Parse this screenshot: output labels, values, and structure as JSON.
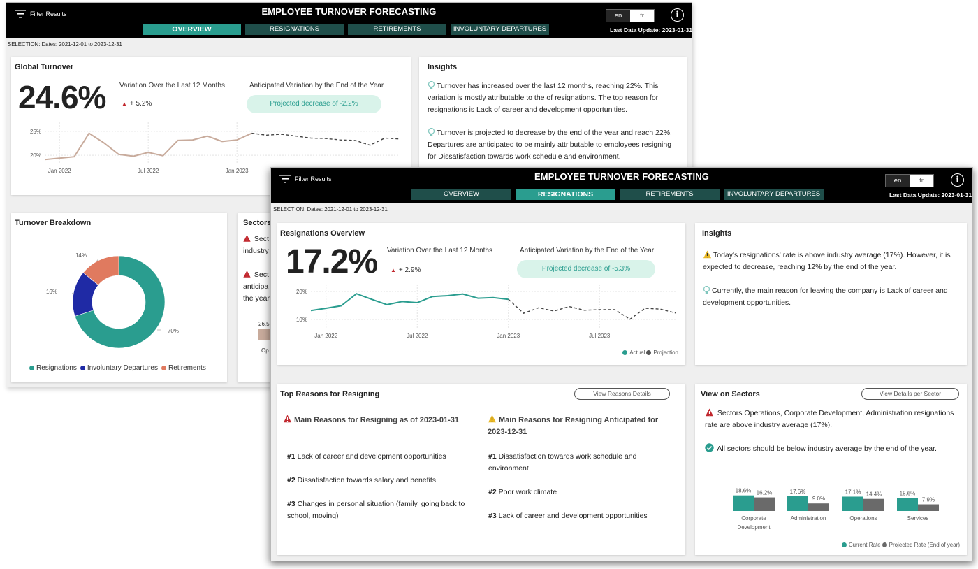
{
  "app": {
    "filter_label": "Filter Results",
    "title": "EMPLOYEE TURNOVER FORECASTING",
    "tabs": [
      "OVERVIEW",
      "RESIGNATIONS",
      "RETIREMENTS",
      "INVOLUNTARY DEPARTURES"
    ],
    "lang_en": "en",
    "lang_fr": "fr",
    "info_glyph": "i",
    "last_update_label": "Last Data Update:",
    "last_update_value": "2023-01-31",
    "selection": "SELECTION: Dates: 2021-12-01 to 2023-12-31"
  },
  "overview": {
    "active_tab": "OVERVIEW",
    "global_turnover": {
      "title": "Global Turnover",
      "value": "24.6%",
      "variation_label": "Variation Over the Last 12 Months",
      "variation_value": "+ 5.2%",
      "anticipated_label": "Anticipated Variation by the End of the Year",
      "projected_pill": "Projected decrease of -2.2%"
    },
    "insights": {
      "title": "Insights",
      "p1": "Turnover has increased over the last 12 months, reaching 22%. This variation is mostly attributable to the of resignations. The top reason for resignations is Lack of career and development opportunities.",
      "p2": "Turnover is projected to decrease by the end of the year and reach 22%. Departures are anticipated to be mainly attributable to employees resigning for Dissatisfaction towards work schedule and environment."
    },
    "breakdown": {
      "title": "Turnover Breakdown",
      "legend": [
        "Resignations",
        "Involuntary Departures",
        "Retirements"
      ]
    },
    "sectors": {
      "title": "Sectors",
      "line1": "Sect",
      "line1b": "industry",
      "line2": "Sect",
      "line2b": "anticipa",
      "line2c": "the year",
      "bar_label": "26.5",
      "cat_label": "Op"
    }
  },
  "resignations": {
    "active_tab": "RESIGNATIONS",
    "overview": {
      "title": "Resignations Overview",
      "value": "17.2%",
      "variation_label": "Variation Over the Last 12 Months",
      "variation_value": "+ 2.9%",
      "anticipated_label": "Anticipated Variation by the End of the Year",
      "projected_pill": "Projected decrease of -5.3%",
      "legend_actual": "Actual",
      "legend_projection": "Projection"
    },
    "insights": {
      "title": "Insights",
      "p1": "Today's resignations' rate is above industry average (17%). However, it is expected to decrease, reaching 12% by the end of the year.",
      "p2": "Currently, the main reason for leaving the company is Lack of career and development opportunities."
    },
    "top_reasons": {
      "title": "Top Reasons for Resigning",
      "button": "View Reasons Details",
      "current_heading": "Main Reasons for Resigning as of 2023-01-31",
      "anticipated_heading": "Main Reasons for Resigning Anticipated for 2023-12-31",
      "current": [
        {
          "rank": "#1",
          "text": "Lack of career and development opportunities"
        },
        {
          "rank": "#2",
          "text": "Dissatisfaction towards salary and benefits"
        },
        {
          "rank": "#3",
          "text": "Changes in personal situation (family, going back to school, moving)"
        }
      ],
      "anticipated": [
        {
          "rank": "#1",
          "text": "Dissatisfaction towards work schedule and environment"
        },
        {
          "rank": "#2",
          "text": "Poor work climate"
        },
        {
          "rank": "#3",
          "text": "Lack of career and development opportunities"
        }
      ]
    },
    "sectors": {
      "title": "View on Sectors",
      "button": "View Details per Sector",
      "warning": "Sectors Operations, Corporate Development, Administration resignations rate are above industry average (17%).",
      "ok": "All sectors should be below industry average by the end of the year.",
      "legend_current": "Current Rate",
      "legend_projected": "Projected Rate (End of year)"
    }
  },
  "colors": {
    "teal": "#2a9d8f",
    "dark_teal_tab": "#1f4e4a",
    "navy": "#1f2aa5",
    "orange": "#e07a5f",
    "tan_line": "#c8ab9c",
    "grey_bar": "#6a6a6a",
    "pill_bg": "#d9f3ea",
    "warning_red": "#c1272d",
    "warning_yellow": "#e9b824",
    "ok_green": "#2a9d8f"
  },
  "icons": [
    "filter-icon",
    "info-icon",
    "lightbulb-icon",
    "warning-red-icon",
    "warning-yellow-icon",
    "check-circle-icon",
    "up-triangle-icon"
  ],
  "chart_data": [
    {
      "type": "line",
      "name_ref": "global-turnover",
      "x_ticks": [
        "Jan 2022",
        "Jul 2022",
        "Jan 2023"
      ],
      "y_ticks": [
        "20%",
        "25%"
      ],
      "ylim": [
        19,
        26
      ],
      "x": [
        "2021-12",
        "2022-01",
        "2022-02",
        "2022-03",
        "2022-04",
        "2022-05",
        "2022-06",
        "2022-07",
        "2022-08",
        "2022-09",
        "2022-10",
        "2022-11",
        "2022-12",
        "2023-01",
        "2023-02",
        "2023-03",
        "2023-04",
        "2023-05",
        "2023-06",
        "2023-07",
        "2023-08",
        "2023-09",
        "2023-10",
        "2023-11",
        "2023-12"
      ],
      "series": [
        {
          "kind": "actual",
          "values": [
            19.1,
            19.4,
            19.7,
            24.6,
            22.6,
            20.2,
            19.8,
            20.6,
            19.9,
            23.1,
            23.2,
            24.0,
            22.9,
            23.2,
            24.6,
            null,
            null,
            null,
            null,
            null,
            null,
            null,
            null,
            null,
            null
          ]
        },
        {
          "kind": "projection",
          "values": [
            null,
            null,
            null,
            null,
            null,
            null,
            null,
            null,
            null,
            null,
            null,
            null,
            null,
            null,
            24.6,
            24.2,
            24.4,
            24.0,
            23.6,
            23.5,
            23.2,
            23.1,
            22.1,
            23.6,
            23.4
          ]
        }
      ]
    },
    {
      "type": "pie",
      "name_ref": "turnover-breakdown",
      "labels": [
        "Resignations",
        "Involuntary Departures",
        "Retirements"
      ],
      "values": [
        70,
        16,
        14
      ],
      "value_labels": [
        "70%",
        "16%",
        "14%"
      ]
    },
    {
      "type": "line",
      "name_ref": "resignations-overview",
      "x_ticks": [
        "Jan 2022",
        "Jul 2022",
        "Jan 2023",
        "Jul 2023"
      ],
      "y_ticks": [
        "10%",
        "20%"
      ],
      "ylim": [
        8,
        21
      ],
      "x": [
        "2021-12",
        "2022-01",
        "2022-02",
        "2022-03",
        "2022-04",
        "2022-05",
        "2022-06",
        "2022-07",
        "2022-08",
        "2022-09",
        "2022-10",
        "2022-11",
        "2022-12",
        "2023-01",
        "2023-02",
        "2023-03",
        "2023-04",
        "2023-05",
        "2023-06",
        "2023-07",
        "2023-08",
        "2023-09",
        "2023-10",
        "2023-11",
        "2023-12"
      ],
      "series": [
        {
          "name": "Actual",
          "kind": "actual",
          "values": [
            13.2,
            14.0,
            14.9,
            19.2,
            17.2,
            15.3,
            16.4,
            16.0,
            18.2,
            18.5,
            19.1,
            17.6,
            17.8,
            17.2,
            null,
            null,
            null,
            null,
            null,
            null,
            null,
            null,
            null,
            null,
            null
          ]
        },
        {
          "name": "Projection",
          "kind": "projection",
          "values": [
            null,
            null,
            null,
            null,
            null,
            null,
            null,
            null,
            null,
            null,
            null,
            null,
            null,
            17.2,
            12.2,
            14.2,
            13.0,
            14.6,
            13.3,
            13.5,
            13.5,
            10.1,
            14.0,
            13.7,
            12.3
          ]
        }
      ]
    },
    {
      "type": "bar",
      "name_ref": "sectors-rates",
      "categories": [
        "Corporate Development",
        "Administration",
        "Operations",
        "Services"
      ],
      "series": [
        {
          "name": "Current Rate",
          "values": [
            18.6,
            17.6,
            17.1,
            15.6
          ]
        },
        {
          "name": "Projected Rate (End of year)",
          "values": [
            16.2,
            9.0,
            14.4,
            7.9
          ]
        }
      ],
      "value_labels_current": [
        "18.6%",
        "17.6%",
        "17.1%",
        "15.6%"
      ],
      "value_labels_projected": [
        "16.2%",
        "9.0%",
        "14.4%",
        "7.9%"
      ]
    }
  ]
}
